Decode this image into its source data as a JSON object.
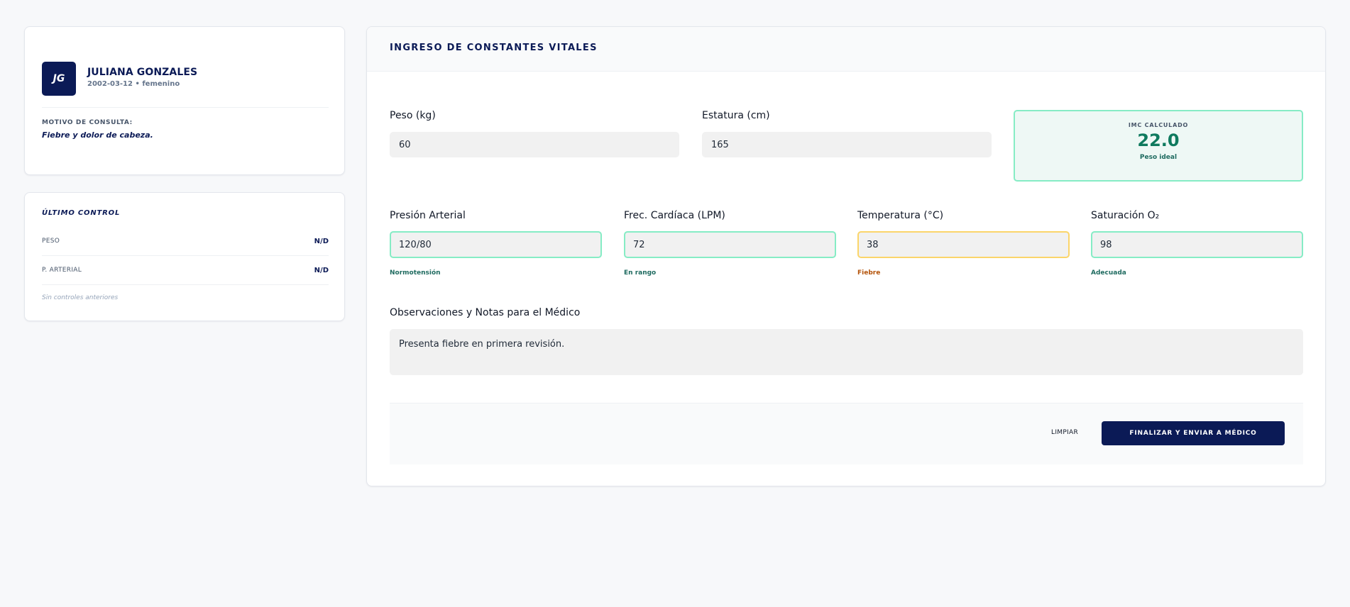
{
  "patient": {
    "initials": "JG",
    "name": "JULIANA GONZALES",
    "meta": "2002-03-12 • femenino",
    "reason_label": "MOTIVO DE CONSULTA:",
    "reason": "Fiebre y dolor de cabeza."
  },
  "last_control": {
    "title": "ÚLTIMO CONTROL",
    "rows": [
      {
        "label": "PESO",
        "value": "N/D"
      },
      {
        "label": "P. ARTERIAL",
        "value": "N/D"
      }
    ],
    "empty_text": "Sin controles anteriores"
  },
  "main": {
    "title": "INGRESO DE CONSTANTES VITALES",
    "weight": {
      "label": "Peso (kg)",
      "value": "60"
    },
    "height": {
      "label": "Estatura (cm)",
      "value": "165"
    },
    "imc": {
      "label": "IMC CALCULADO",
      "value": "22.0",
      "status": "Peso ideal"
    },
    "vitals": [
      {
        "label": "Presión Arterial",
        "value": "120/80",
        "status": "Normotensión"
      },
      {
        "label": "Frec. Cardíaca (LPM)",
        "value": "72",
        "status": "En rango"
      },
      {
        "label": "Temperatura (°C)",
        "value": "38",
        "status": "Fiebre"
      },
      {
        "label": "Saturación O₂",
        "value": "98",
        "status": "Adecuada"
      }
    ],
    "notes": {
      "label": "Observaciones y Notas para el Médico",
      "value": "Presenta fiebre en primera revisión."
    },
    "actions": {
      "clear": "LIMPIAR",
      "submit": "FINALIZAR Y ENVIAR A MÉDICO"
    }
  },
  "colors": {
    "brand": "#0b1a56",
    "ok_border": "#86ecc5",
    "warn_border": "#fbd56a",
    "ok_text": "#1f6b60",
    "warn_text": "#b45309",
    "imc_value": "#0f7a5e"
  }
}
